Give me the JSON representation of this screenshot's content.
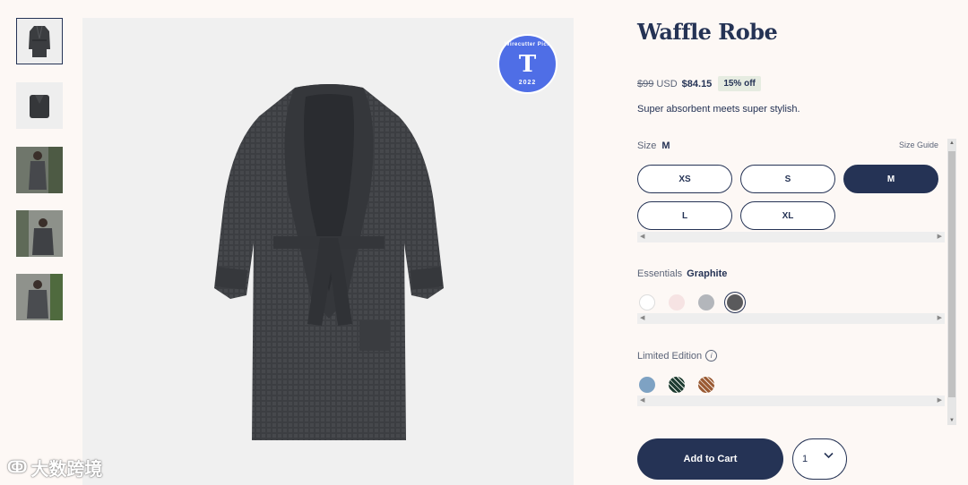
{
  "thumbnails": [
    {
      "icon": "robe-front-icon"
    },
    {
      "icon": "robe-folded-icon"
    },
    {
      "icon": "model-photo-icon"
    },
    {
      "icon": "model-photo-icon"
    },
    {
      "icon": "model-photo-icon"
    }
  ],
  "badge": {
    "top": "Wirecutter Pick",
    "logo": "T",
    "year": "2022"
  },
  "watermark": {
    "text": "大数跨境",
    "icon": "logo-icon"
  },
  "product": {
    "title": "Waffle Robe",
    "old_price": "$99",
    "currency": "USD",
    "price": "$84.15",
    "discount": "15% off",
    "tagline": "Super absorbent meets super stylish."
  },
  "size": {
    "label": "Size",
    "selected": "M",
    "guide": "Size Guide",
    "options": [
      "XS",
      "S",
      "M",
      "L",
      "XL"
    ]
  },
  "essentials": {
    "label": "Essentials",
    "selected": "Graphite",
    "colors": [
      "#ffffff",
      "#f6e3e3",
      "#b3b6bb",
      "#5a5a5c"
    ]
  },
  "limited": {
    "label": "Limited Edition",
    "colors": [
      "#7ea2c3",
      "stripe-green",
      "stripe-brown"
    ]
  },
  "cart": {
    "label": "Add to Cart",
    "quantity": "1"
  },
  "colors": {
    "navy": "#253355",
    "background": "#fdf8f5",
    "badge_blue": "#4f6ee6"
  }
}
